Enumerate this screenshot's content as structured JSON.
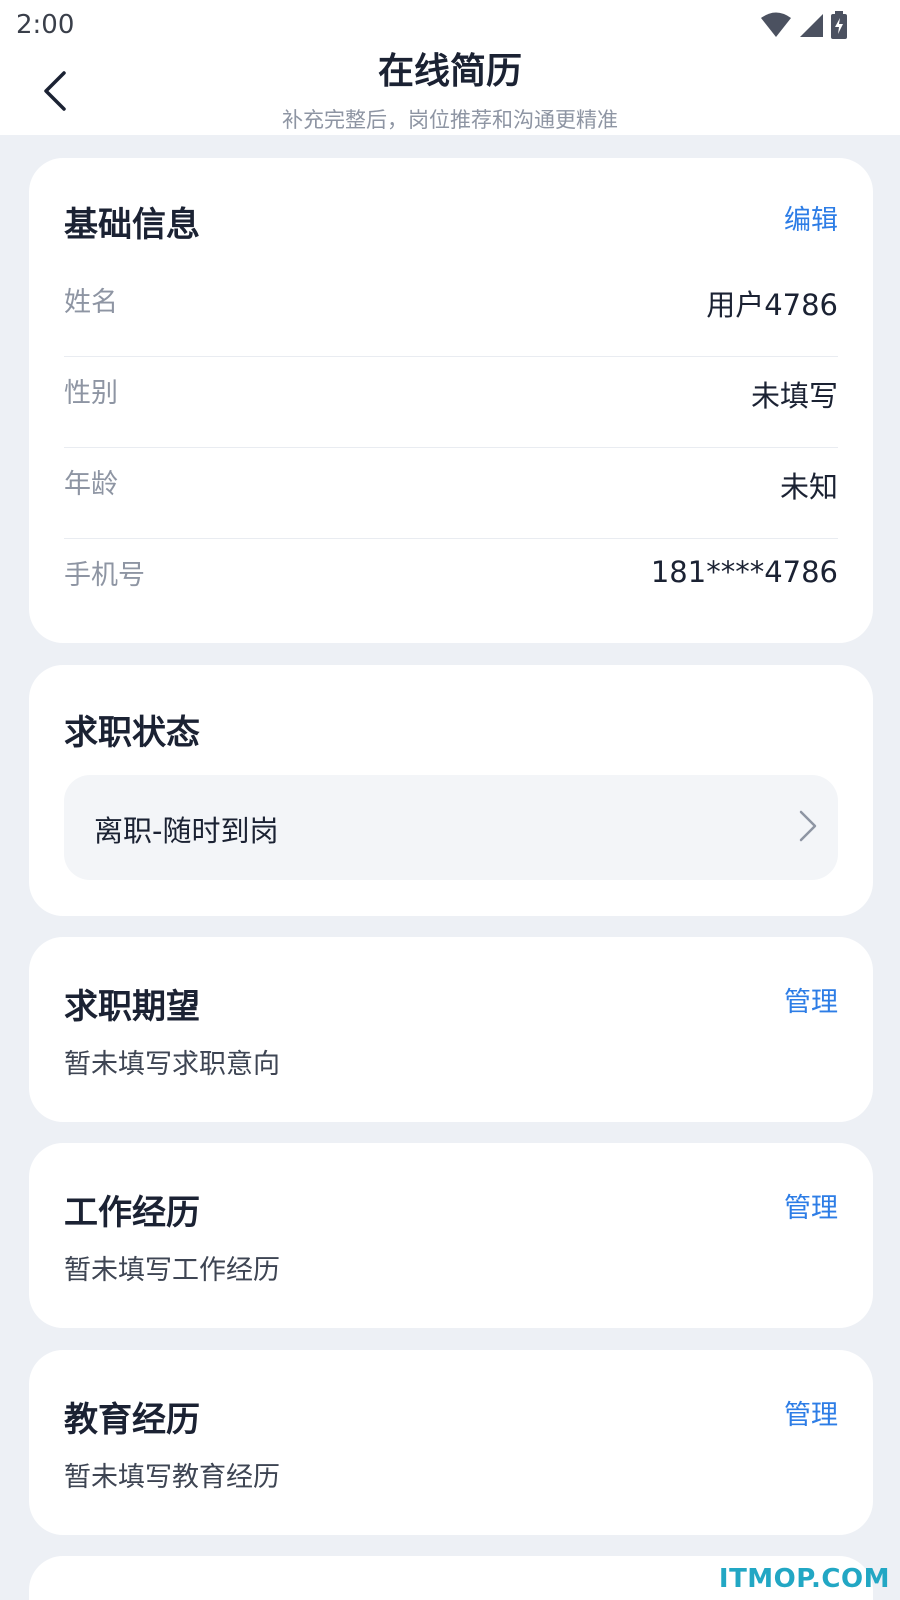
{
  "status_bar": {
    "time": "2:00"
  },
  "header": {
    "title": "在线简历",
    "subtitle": "补充完整后，岗位推荐和沟通更精准"
  },
  "basic_info": {
    "title": "基础信息",
    "action": "编辑",
    "rows": [
      {
        "label": "姓名",
        "value": "用户4786"
      },
      {
        "label": "性别",
        "value": "未填写"
      },
      {
        "label": "年龄",
        "value": "未知"
      },
      {
        "label": "手机号",
        "value": "181****4786"
      }
    ]
  },
  "job_status": {
    "title": "求职状态",
    "selected": "离职-随时到岗"
  },
  "job_expectation": {
    "title": "求职期望",
    "action": "管理",
    "empty_text": "暂未填写求职意向"
  },
  "work_experience": {
    "title": "工作经历",
    "action": "管理",
    "empty_text": "暂未填写工作经历"
  },
  "education": {
    "title": "教育经历",
    "action": "管理",
    "empty_text": "暂未填写教育经历"
  },
  "watermark": "ITMOP.COM",
  "colors": {
    "accent": "#2d7de6",
    "background": "#edf0f5",
    "card": "#ffffff",
    "muted_text": "#8e95a3",
    "watermark": "#22a7c4"
  }
}
